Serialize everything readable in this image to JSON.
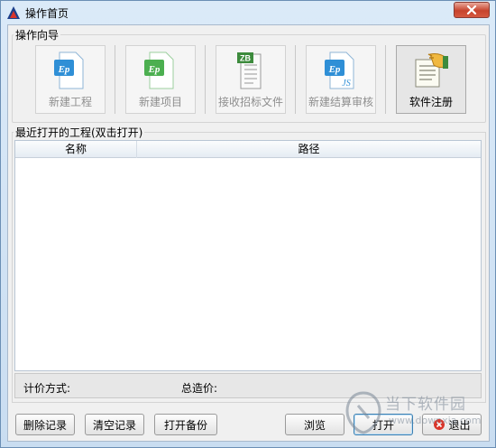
{
  "window": {
    "title": "操作首页"
  },
  "guide": {
    "legend": "操作向导",
    "tiles": [
      {
        "label": "新建工程",
        "icon": "ep-file-icon",
        "color": "#2f8fd6",
        "enabled": false
      },
      {
        "label": "新建项目",
        "icon": "ep-file-icon",
        "color": "#4caf50",
        "enabled": false
      },
      {
        "label": "接收招标文件",
        "icon": "zb-document-icon",
        "color": "#3d8b3d",
        "enabled": false
      },
      {
        "label": "新建结算审核",
        "icon": "ep-js-file-icon",
        "color": "#2f8fd6",
        "enabled": false
      },
      {
        "label": "软件注册",
        "icon": "register-hand-icon",
        "color": "#e0a030",
        "enabled": true
      }
    ]
  },
  "recent": {
    "legend": "最近打开的工程(双击打开)",
    "columns": [
      "名称",
      "路径"
    ],
    "rows": []
  },
  "status": {
    "pricing_label": "计价方式:",
    "total_label": "总造价:"
  },
  "buttons": {
    "delete_record": "删除记录",
    "clear_records": "清空记录",
    "open_backup": "打开备份",
    "browse": "浏览",
    "open": "打开",
    "exit": "退出"
  },
  "watermark": {
    "text": "当下软件园",
    "url": "www.downxia.com"
  }
}
